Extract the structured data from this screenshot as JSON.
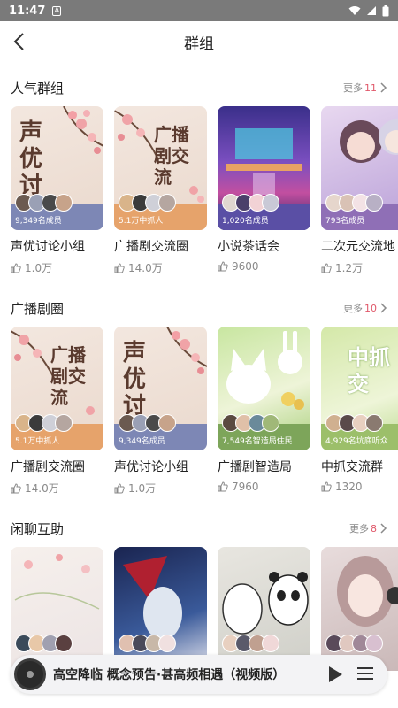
{
  "status": {
    "time": "11:47",
    "sim_icon": "A"
  },
  "header": {
    "title": "群组"
  },
  "sections": [
    {
      "title": "人气群组",
      "more_label": "更多",
      "more_count": "11",
      "cards": [
        {
          "name": "声优讨论小组",
          "members": "9,349名成员",
          "likes": "1.0万",
          "cover_text": "声优讨",
          "band": "#7d87b5"
        },
        {
          "name": "广播剧交流圈",
          "members": "5.1万中抓人",
          "likes": "14.0万",
          "cover_text": "广播剧交流",
          "band": "#e6a36b"
        },
        {
          "name": "小说茶话会",
          "members": "1,020名成员",
          "likes": "9600",
          "cover_text": "",
          "band": "#5a4fa5"
        },
        {
          "name": "二次元交流地",
          "members": "793名成员",
          "likes": "1.2万",
          "cover_text": "",
          "band": "#8f6fb6"
        }
      ]
    },
    {
      "title": "广播剧圈",
      "more_label": "更多",
      "more_count": "10",
      "cards": [
        {
          "name": "广播剧交流圈",
          "members": "5.1万中抓人",
          "likes": "14.0万",
          "cover_text": "广播剧交流",
          "band": "#e6a36b"
        },
        {
          "name": "声优讨论小组",
          "members": "9,349名成员",
          "likes": "1.0万",
          "cover_text": "声优讨",
          "band": "#7d87b5"
        },
        {
          "name": "广播剧智造局",
          "members": "7,549名智造局住民",
          "likes": "7960",
          "cover_text": "",
          "band": "#7da55a"
        },
        {
          "name": "中抓交流群",
          "members": "4,929名坑底听众",
          "likes": "1320",
          "cover_text": "中抓交",
          "band": "#9cbf6a"
        }
      ]
    },
    {
      "title": "闲聊互助",
      "more_label": "更多",
      "more_count": "8",
      "cards": [
        {
          "name": "",
          "members": "",
          "likes": "",
          "cover_text": "",
          "band": "#e9e3e3"
        },
        {
          "name": "",
          "members": "",
          "likes": "",
          "cover_text": "",
          "band": "#3a4a80"
        },
        {
          "name": "",
          "members": "",
          "likes": "",
          "cover_text": "",
          "band": "#cfcfcf"
        },
        {
          "name": "",
          "members": "",
          "likes": "",
          "cover_text": "",
          "band": "#d7c9c9"
        }
      ]
    }
  ],
  "player": {
    "track": "高空降临 概念预告·甚高频相遇（视频版）"
  },
  "colors": {
    "accent": "#e0586a",
    "muted": "#8a8a8a",
    "statusbar": "#7a7a7a"
  }
}
